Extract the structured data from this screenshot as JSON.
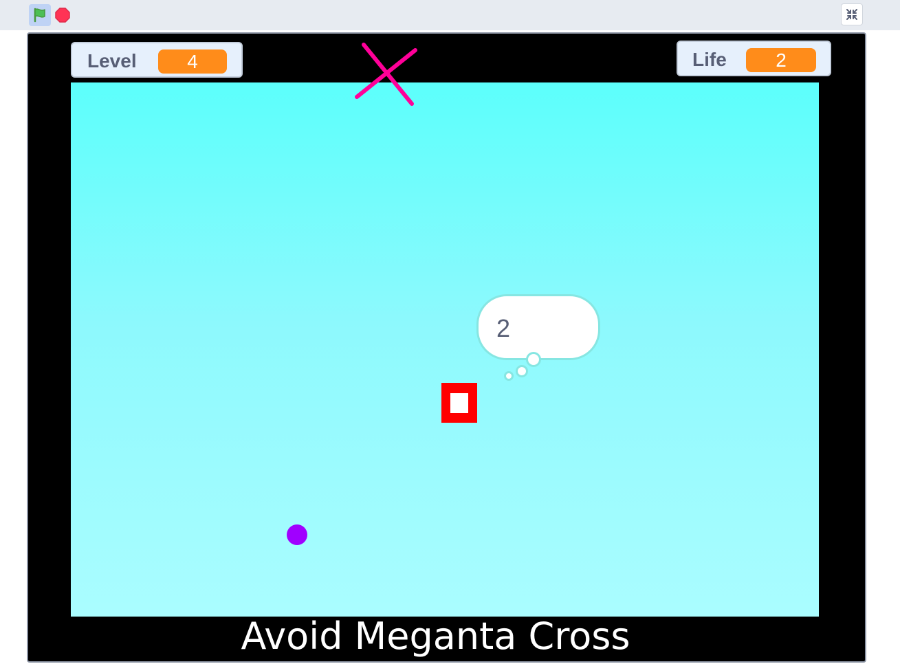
{
  "toolbar": {
    "green_flag_icon": "green-flag-icon",
    "stop_icon": "stop-sign-icon",
    "fullscreen_icon": "exit-fullscreen-icon"
  },
  "monitors": {
    "level": {
      "label": "Level",
      "value": "4"
    },
    "life": {
      "label": "Life",
      "value": "2"
    }
  },
  "sprites": {
    "thought_bubble_text": "2",
    "enemy_color": "#ff0099",
    "player_color": "#ff0000",
    "dot_color": "#a000ff"
  },
  "caption": "Avoid Meganta Cross",
  "colors": {
    "stage_top": "#5cfffc",
    "stage_bottom": "#aafdff",
    "monitor_value_bg": "#ff8c1a"
  }
}
